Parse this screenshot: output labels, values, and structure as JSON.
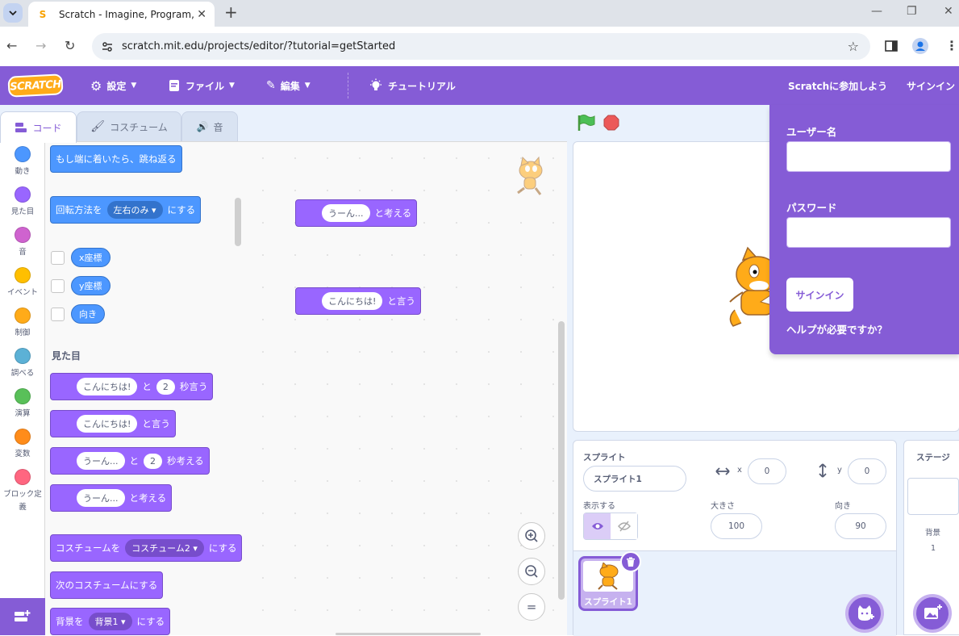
{
  "browser": {
    "tab_title": "Scratch - Imagine, Program, Share",
    "favicon": "S",
    "url": "scratch.mit.edu/projects/editor/?tutorial=getStarted"
  },
  "menu": {
    "logo": "SCRATCH",
    "settings": "設定",
    "file": "ファイル",
    "edit": "編集",
    "tutorials": "チュートリアル",
    "join": "Scratchに参加しよう",
    "signin": "サインイン"
  },
  "tabs": {
    "code": "コード",
    "costume": "コスチューム",
    "sound": "音"
  },
  "categories": [
    {
      "label": "動き",
      "color": "#4c97ff"
    },
    {
      "label": "見た目",
      "color": "#9966ff"
    },
    {
      "label": "音",
      "color": "#cf63cf"
    },
    {
      "label": "イベント",
      "color": "#ffbf00"
    },
    {
      "label": "制御",
      "color": "#ffab19"
    },
    {
      "label": "調べる",
      "color": "#5cb1d6"
    },
    {
      "label": "演算",
      "color": "#59c059"
    },
    {
      "label": "変数",
      "color": "#ff8c1a"
    },
    {
      "label": "ブロック定義",
      "color": "#ff6680"
    }
  ],
  "palette": {
    "bounce": "もし端に着いたら、跳ね返る",
    "rot_pre": "回転方法を",
    "rot_dd": "左右のみ",
    "rot_post": "にする",
    "xpos": "x座標",
    "ypos": "y座標",
    "dir": "向き",
    "looks_title": "見た目",
    "say_secs": {
      "text": "こんにちは!",
      "and": "と",
      "num": "2",
      "post": "秒言う"
    },
    "say": {
      "text": "こんにちは!",
      "post": "と言う"
    },
    "think_secs": {
      "text": "うーん...",
      "and": "と",
      "num": "2",
      "post": "秒考える"
    },
    "think": {
      "text": "うーん...",
      "post": "と考える"
    },
    "costume": {
      "pre": "コスチュームを",
      "dd": "コスチューム2",
      "post": "にする"
    },
    "next_costume": "次のコスチュームにする",
    "backdrop": {
      "pre": "背景を",
      "dd": "背景1",
      "post": "にする"
    }
  },
  "workspace": {
    "think": {
      "text": "うーん...",
      "post": "と考える"
    },
    "say": {
      "text": "こんにちは!",
      "post": "と言う"
    },
    "zoom_reset": "="
  },
  "sprite": {
    "title": "スプライト",
    "name": "スプライト1",
    "x_label": "x",
    "x": "0",
    "y_label": "y",
    "y": "0",
    "show_label": "表示する",
    "size_label": "大きさ",
    "size": "100",
    "dir_label": "向き",
    "direction": "90",
    "thumb_name": "スプライト1"
  },
  "stage_pane": {
    "title": "ステージ",
    "backdrops_label": "背景",
    "backdrops_count": "1"
  },
  "signin": {
    "username": "ユーザー名",
    "password": "パスワード",
    "button": "サインイン",
    "help": "ヘルプが必要ですか？"
  },
  "colors": {
    "accent": "#855cd6",
    "motion": "#4c97ff",
    "looks": "#9966ff"
  }
}
